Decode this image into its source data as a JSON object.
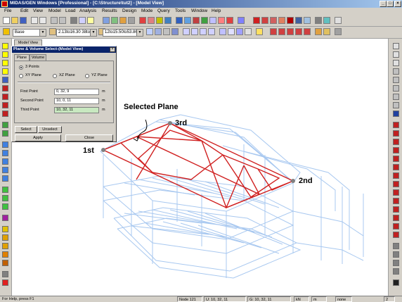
{
  "window": {
    "title": "MIDAS/GEN Windows [Professional] - [C:\\Structure\\tut2] - [Model View]"
  },
  "menu": [
    "File",
    "Edit",
    "View",
    "Model",
    "Load",
    "Analysis",
    "Results",
    "Design",
    "Mode",
    "Query",
    "Tools",
    "Window",
    "Help"
  ],
  "toolbar2": {
    "base_combo": "Base",
    "section_combo": "2.13to16.30 38to4",
    "section_combo2": "12to15.50to53.86t"
  },
  "viewport": {
    "tab_label": "Model View"
  },
  "dialog": {
    "title": "Plane & Volume Select-(Model View)",
    "tabs": [
      "Plane",
      "Volume"
    ],
    "option_3points": "3 Points",
    "option_xy": "XY Plane",
    "option_xz": "XZ Plane",
    "option_yz": "YZ Plane",
    "first_point_label": "First Point",
    "first_point_value": "0, 32, 9",
    "second_point_label": "Second Point",
    "second_point_value": "10, 0, 11",
    "third_point_label": "Third Point",
    "third_point_value": "10, 32, 11",
    "unit": "m",
    "select_button": "Select",
    "unselect_button": "Unselect",
    "apply_button": "Apply",
    "close_button": "Close"
  },
  "annotations": {
    "selected_plane": "Selected Plane",
    "first": "1st",
    "second": "2nd",
    "third": "3rd"
  },
  "status": {
    "help": "For Help, press F1",
    "node": "Node 121",
    "u": "U: 10, 32, 11",
    "g": "G: 10, 32, 11",
    "unit_force": "kN",
    "unit_len": "m",
    "mode": "none",
    "page": "2"
  },
  "colors": {
    "selected": "#d02020",
    "model": "#a8c8f0",
    "title_bar": "#0a246a"
  }
}
